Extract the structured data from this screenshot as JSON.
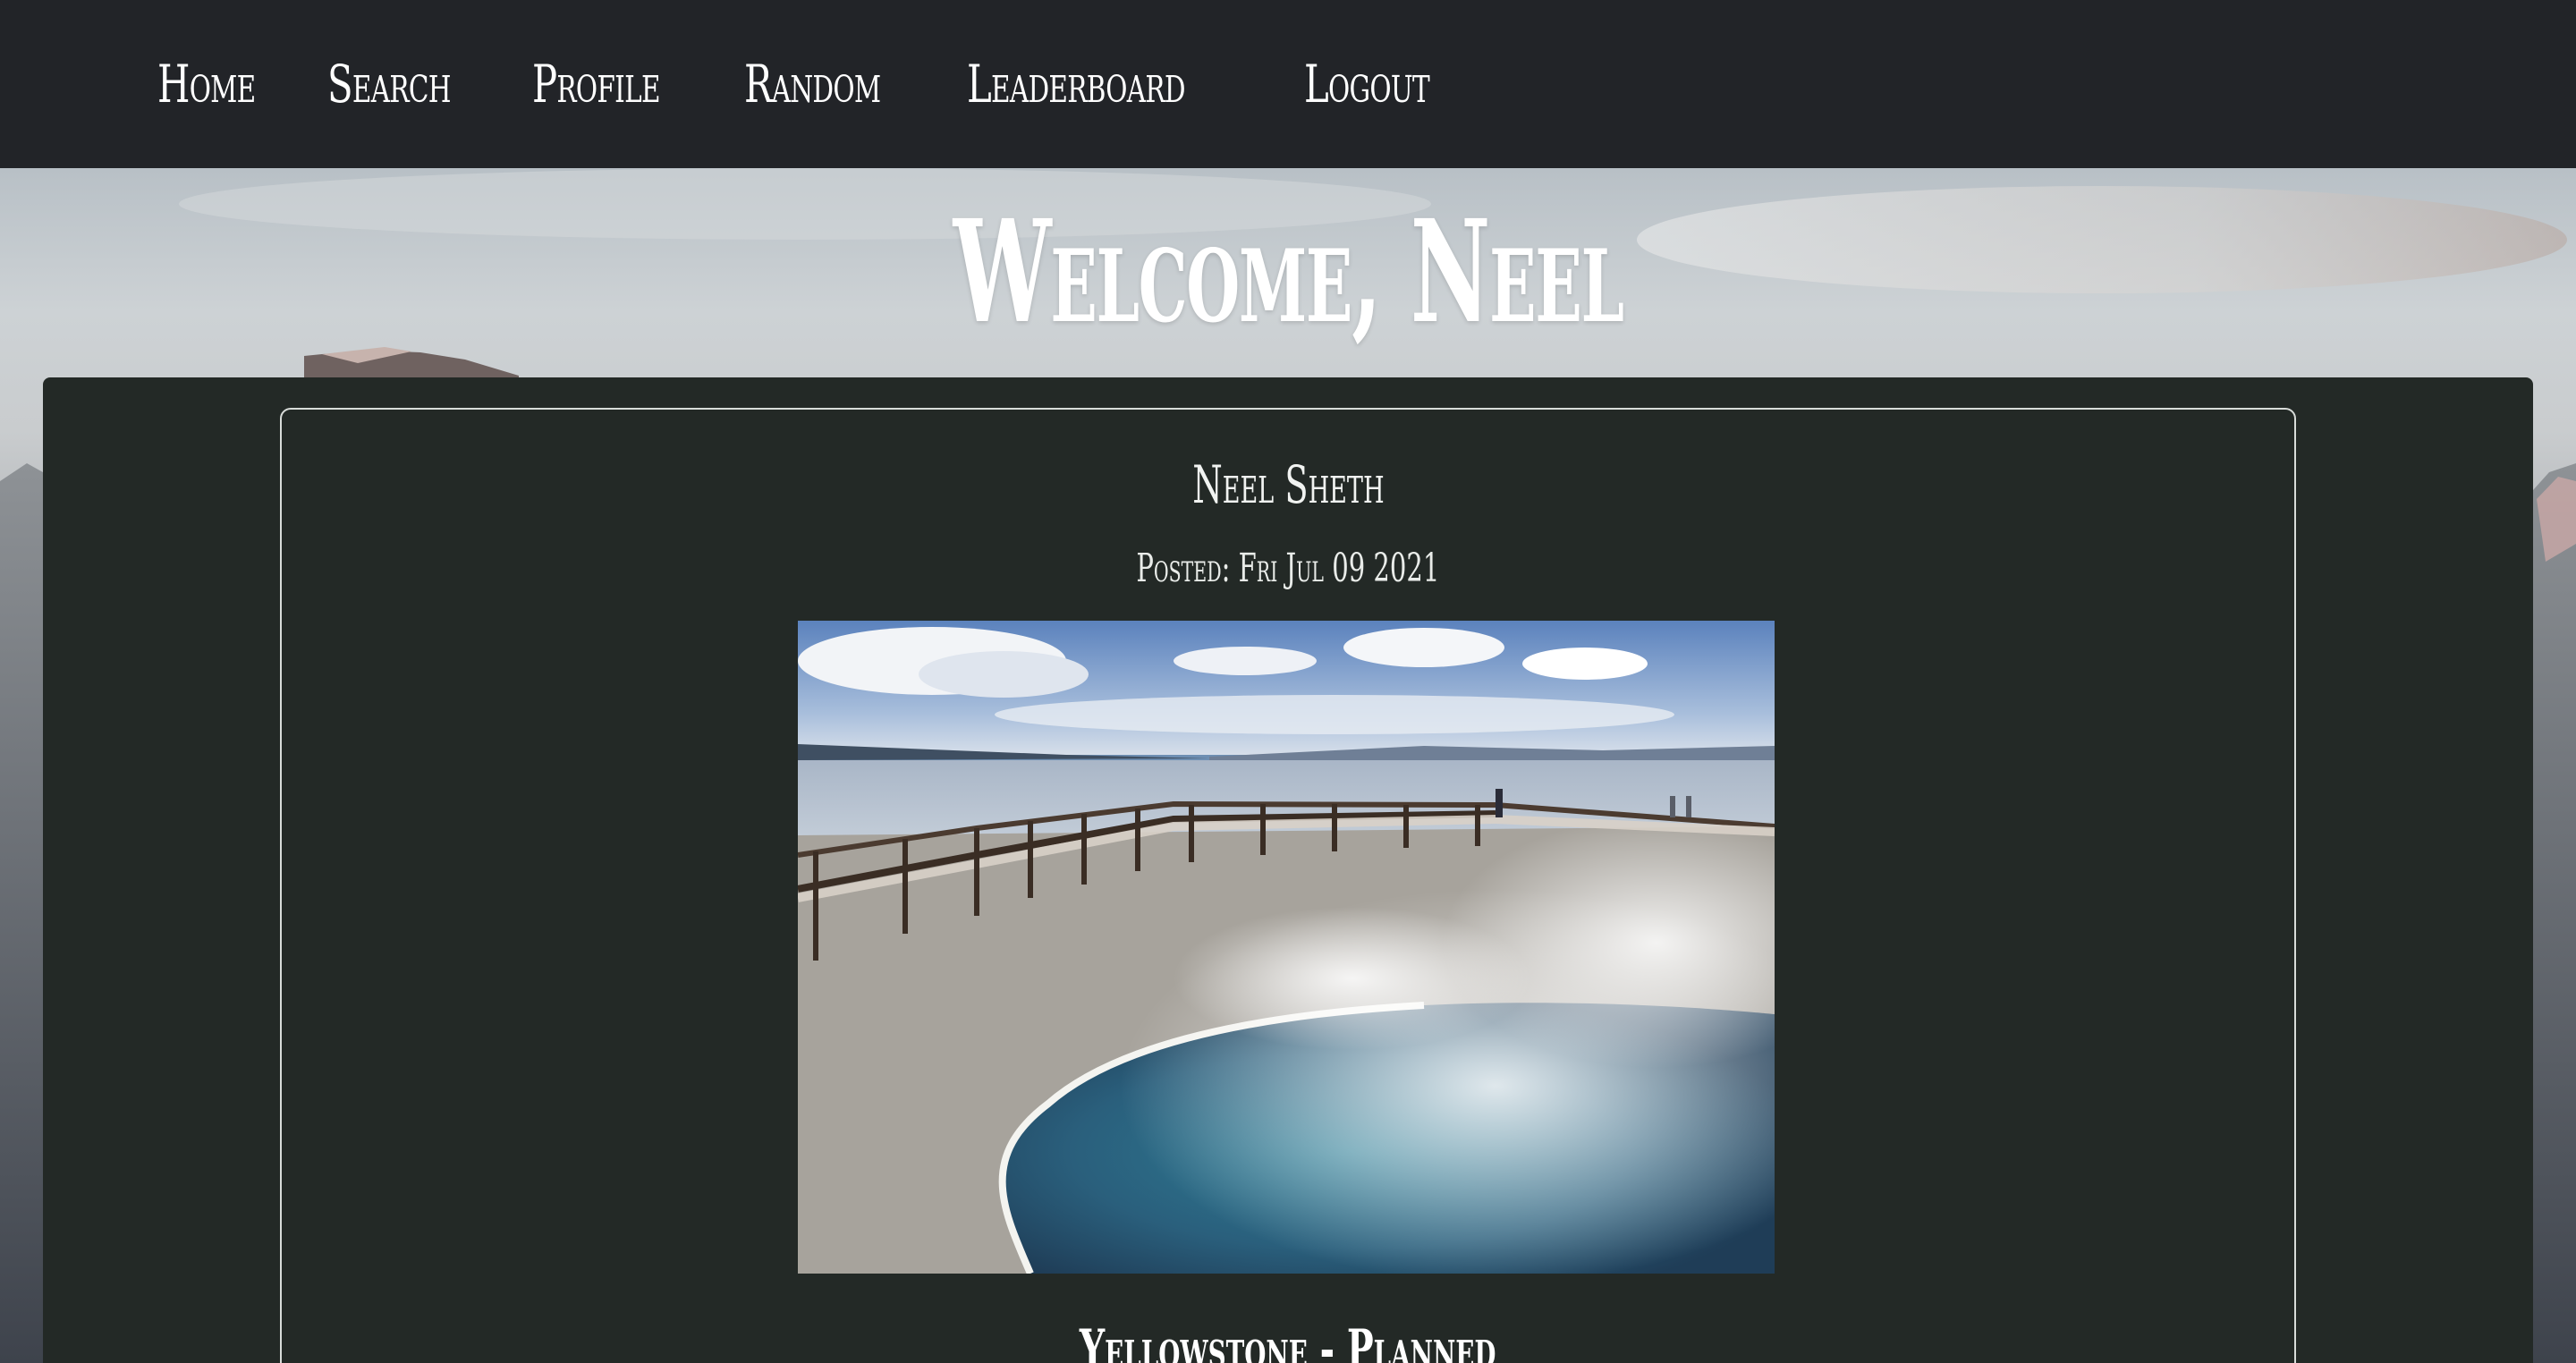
{
  "nav": {
    "items": [
      {
        "label": "Home"
      },
      {
        "label": "Search"
      },
      {
        "label": "Profile"
      },
      {
        "label": "Random"
      },
      {
        "label": "Leaderboard"
      },
      {
        "label": "Logout"
      }
    ]
  },
  "hero": {
    "welcome": "Welcome, Neel"
  },
  "post": {
    "author": "Neel Sheth",
    "posted": "Posted: Fri Jul 09 2021",
    "photo_subject": "hot-spring-boardwalk-photo",
    "title": "Yellowstone - Planned"
  },
  "colors": {
    "navbar_bg": "#222428",
    "panel_bg": "#232926",
    "text": "#ffffff"
  }
}
